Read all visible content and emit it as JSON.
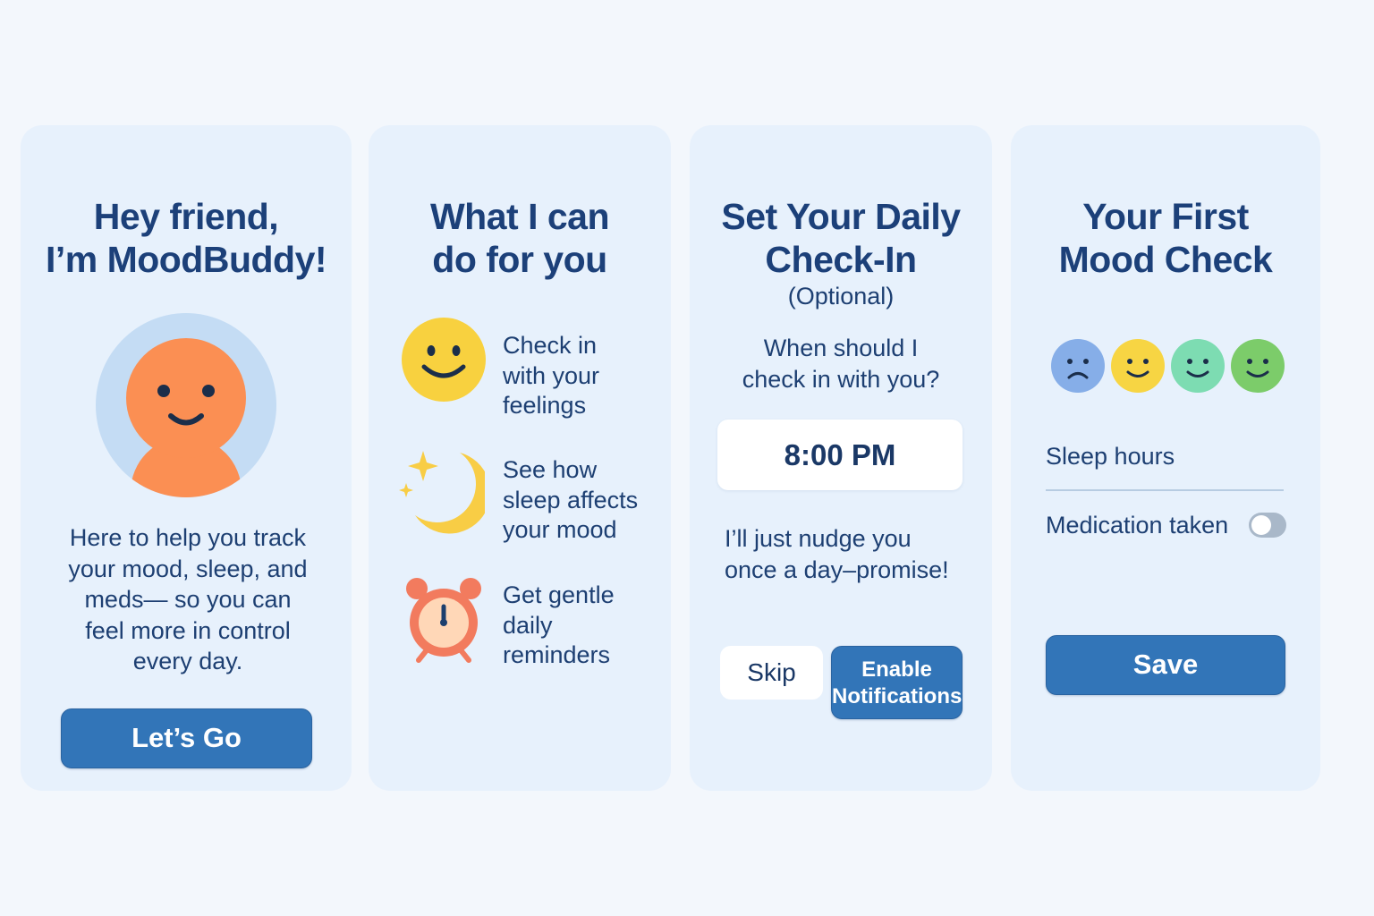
{
  "screens": {
    "welcome": {
      "title_lines": [
        "Hey friend,",
        "I’m MoodBuddy!"
      ],
      "intro_lines": [
        "Here to help you track",
        "your mood, sleep, and",
        "meds— so you can",
        "feel more in control",
        "every day."
      ],
      "cta_label": "Let’s Go",
      "avatar_icon": "smiling-person-icon"
    },
    "features": {
      "title_lines": [
        "What I can",
        "do for you"
      ],
      "items": [
        {
          "icon": "smiley-face-icon",
          "lines": [
            "Check in",
            "with your",
            "feelings"
          ]
        },
        {
          "icon": "moon-stars-icon",
          "lines": [
            "See how",
            "sleep affects",
            "your mood"
          ]
        },
        {
          "icon": "alarm-clock-icon",
          "lines": [
            "Get gentle",
            "daily",
            "reminders"
          ]
        }
      ]
    },
    "checkin": {
      "title_lines": [
        "Set Your Daily",
        "Check-In"
      ],
      "optional_label": "(Optional)",
      "question_lines": [
        "When should I",
        "check in with you?"
      ],
      "time_value": "8:00 PM",
      "nudge_lines": [
        "I’ll just nudge you",
        "once a day–promise!"
      ],
      "skip_label": "Skip",
      "enable_label_lines": [
        "Enable",
        "Notifications"
      ]
    },
    "mood_check": {
      "title_lines": [
        "Your First",
        "Mood Check"
      ],
      "mood_options": [
        {
          "icon": "sad-face-icon",
          "color": "#86aee8"
        },
        {
          "icon": "happy-face-icon",
          "color": "#f7d543"
        },
        {
          "icon": "happy-face-icon",
          "color": "#7ddcb2"
        },
        {
          "icon": "happy-face-icon",
          "color": "#7ccc6a"
        }
      ],
      "sleep_label": "Sleep hours",
      "medication_label": "Medication taken",
      "medication_taken": false,
      "save_label": "Save"
    }
  },
  "colors": {
    "background": "#f3f7fc",
    "card": "#e7f1fc",
    "primary_button": "#3275b8",
    "title_text": "#1c4079",
    "avatar_orange": "#fb8f53",
    "avatar_halo": "#c4dcf4"
  }
}
